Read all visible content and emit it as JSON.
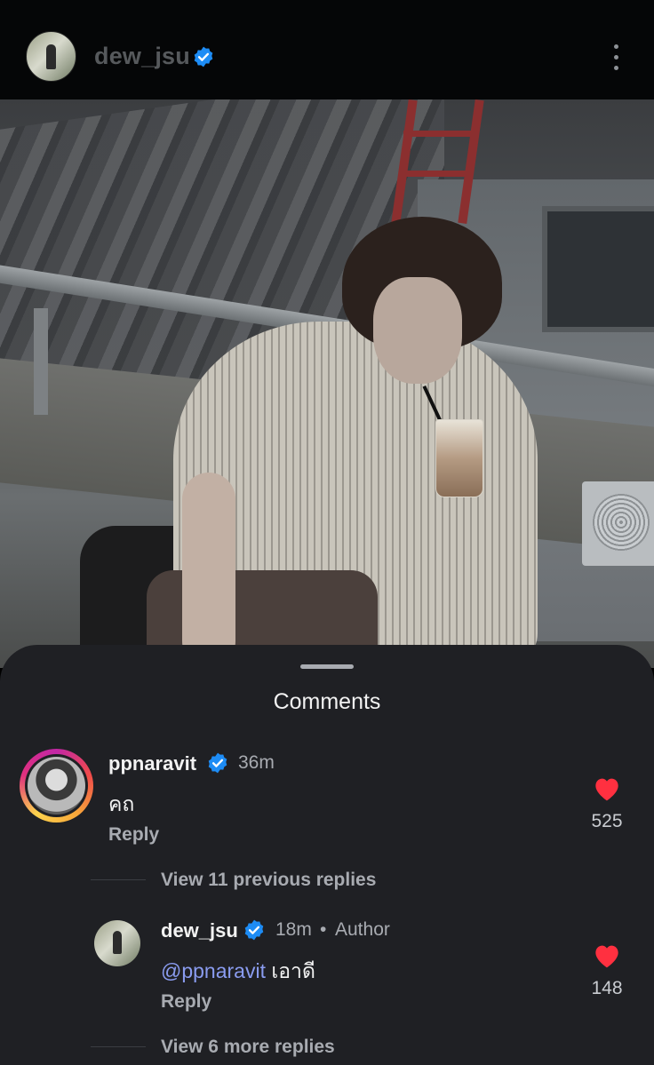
{
  "header": {
    "username": "dew_jsu",
    "verified": true,
    "more_icon": "more-vertical-icon"
  },
  "photo": {
    "description_icon": "post-photo"
  },
  "comments_sheet": {
    "title": "Comments",
    "comments": [
      {
        "username": "ppnaravit",
        "verified": true,
        "time": "36m",
        "text": "คถ",
        "reply_label": "Reply",
        "likes": "525",
        "view_replies_label": "View 11 previous replies"
      },
      {
        "username": "dew_jsu",
        "verified": true,
        "time": "18m",
        "separator": "•",
        "author_label": "Author",
        "mention": "@ppnaravit",
        "text": " เอาดี",
        "reply_label": "Reply",
        "likes": "148",
        "view_replies_label": "View 6 more replies"
      }
    ]
  },
  "colors": {
    "sheet_bg": "#1f2024",
    "verified_blue": "#1d8cf5",
    "heart_red": "#ff3040",
    "mention": "#8a9cf0"
  }
}
